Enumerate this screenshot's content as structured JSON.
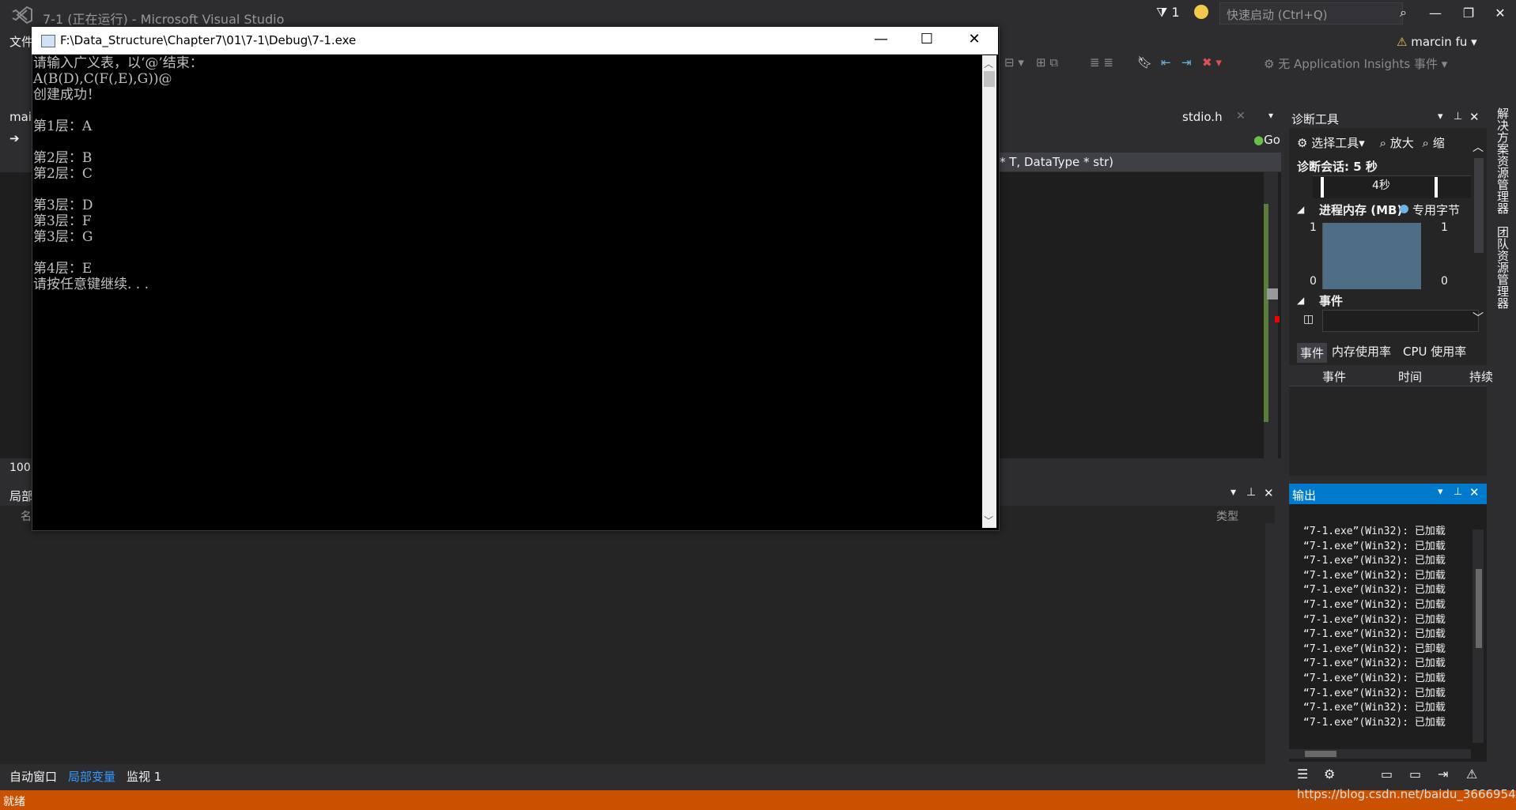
{
  "vs": {
    "title": "7-1 (正在运行) - Microsoft Visual Studio",
    "notif_count": "1",
    "quick_launch_placeholder": "快速启动 (Ctrl+Q)",
    "user": "marcin fu",
    "menu_first": "文件",
    "toolbar_ai": "无 Application Insights 事件"
  },
  "editor": {
    "tab_left": "mai",
    "tab_stdio": "stdio.h",
    "go": "Go",
    "signature": "* T, DataType * str)",
    "zoom": "100"
  },
  "locals": {
    "title": "局部",
    "col_name": "名",
    "col_type": "类型",
    "tabs": [
      "自动窗口",
      "局部变量",
      "监视 1"
    ]
  },
  "diag": {
    "title": "诊断工具",
    "select_tool": "选择工具",
    "zoom_in": "放大",
    "zoom_out": "缩",
    "session": "诊断会话: 5 秒",
    "tick": "4秒",
    "mem_header": "进程内存 (MB)",
    "mem_legend": "专用字节",
    "mem_max_left": "1",
    "mem_min_left": "0",
    "mem_max_right": "1",
    "mem_min_right": "0",
    "events_header": "事件",
    "tabs": [
      "事件",
      "内存使用率",
      "CPU 使用率"
    ],
    "grid_cols": [
      "事件",
      "时间",
      "持续"
    ]
  },
  "side_tabs": [
    "解决方案资源管理器",
    "团队资源管理器"
  ],
  "output": {
    "title": "输出",
    "lines": [
      "“7-1.exe”(Win32): 已加载",
      "“7-1.exe”(Win32): 已加载",
      "“7-1.exe”(Win32): 已加载",
      "“7-1.exe”(Win32): 已加载",
      "“7-1.exe”(Win32): 已加载",
      "“7-1.exe”(Win32): 已加载",
      "“7-1.exe”(Win32): 已加载",
      "“7-1.exe”(Win32): 已加载",
      "“7-1.exe”(Win32): 已卸载",
      "“7-1.exe”(Win32): 已加载",
      "“7-1.exe”(Win32): 已加载",
      "“7-1.exe”(Win32): 已加载",
      "“7-1.exe”(Win32): 已加载",
      "“7-1.exe”(Win32): 已加载"
    ]
  },
  "status": {
    "text": "就绪",
    "watermark": "https://blog.csdn.net/baidu_36669549"
  },
  "console": {
    "title": "F:\\Data_Structure\\Chapter7\\01\\7-1\\Debug\\7-1.exe",
    "lines": [
      "请输入广义表，以‘@’结束：",
      "A(B(D),C(F(,E),G))@",
      "创建成功！",
      "",
      "第1层：A",
      "",
      "第2层：B",
      "第2层：C",
      "",
      "第3层：D",
      "第3层：F",
      "第3层：G",
      "",
      "第4层：E",
      "请按任意键继续. . ."
    ]
  },
  "colors": {
    "vs_bg": "#2d2d30",
    "accent": "#007acc",
    "status_bg": "#ca5100",
    "console_bg": "#000000",
    "console_text": "#c0c0c0"
  }
}
